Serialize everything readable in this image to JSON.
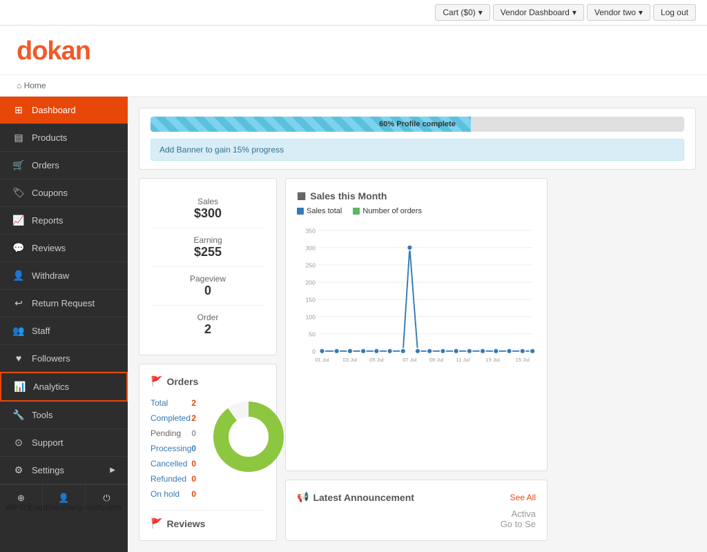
{
  "topnav": {
    "cart_label": "Cart ($0)",
    "vendor_dashboard_label": "Vendor Dashboard",
    "vendor_two_label": "Vendor two",
    "logout_label": "Log out"
  },
  "logo": {
    "text": "dokan"
  },
  "breadcrumb": {
    "home": "Home"
  },
  "sidebar": {
    "items": [
      {
        "id": "dashboard",
        "label": "Dashboard",
        "icon": "⊞",
        "active": true
      },
      {
        "id": "products",
        "label": "Products",
        "icon": "▤",
        "active": false
      },
      {
        "id": "orders",
        "label": "Orders",
        "icon": "🛒",
        "active": false
      },
      {
        "id": "coupons",
        "label": "Coupons",
        "icon": "🏷",
        "active": false
      },
      {
        "id": "reports",
        "label": "Reports",
        "icon": "📈",
        "active": false
      },
      {
        "id": "reviews",
        "label": "Reviews",
        "icon": "💬",
        "active": false
      },
      {
        "id": "withdraw",
        "label": "Withdraw",
        "icon": "👤",
        "active": false
      },
      {
        "id": "return-request",
        "label": "Return Request",
        "icon": "↩",
        "active": false
      },
      {
        "id": "staff",
        "label": "Staff",
        "icon": "👥",
        "active": false
      },
      {
        "id": "followers",
        "label": "Followers",
        "icon": "♥",
        "active": false
      },
      {
        "id": "analytics",
        "label": "Analytics",
        "icon": "📊",
        "active": false,
        "selected": true
      },
      {
        "id": "tools",
        "label": "Tools",
        "icon": "🔧",
        "active": false
      },
      {
        "id": "support",
        "label": "Support",
        "icon": "⊙",
        "active": false
      },
      {
        "id": "settings",
        "label": "Settings",
        "icon": "⚙",
        "active": false,
        "has_arrow": true
      }
    ]
  },
  "progress": {
    "label": "60% Profile complete",
    "percent": 60,
    "banner_text": "Add Banner to gain 15% progress"
  },
  "stats": {
    "sales_label": "Sales",
    "sales_value": "$300",
    "earning_label": "Earning",
    "earning_value": "$255",
    "pageview_label": "Pageview",
    "pageview_value": "0",
    "order_label": "Order",
    "order_value": "2"
  },
  "orders": {
    "title": "Orders",
    "rows": [
      {
        "label": "Total",
        "value": "2",
        "color": "orange",
        "link": true
      },
      {
        "label": "Completed",
        "value": "2",
        "color": "orange",
        "link": true
      },
      {
        "label": "Pending",
        "value": "0",
        "color": "gray",
        "link": false
      },
      {
        "label": "Processing",
        "value": "0",
        "color": "blue",
        "link": true
      },
      {
        "label": "Cancelled",
        "value": "0",
        "color": "orange",
        "link": true
      },
      {
        "label": "Refunded",
        "value": "0",
        "color": "orange",
        "link": true
      },
      {
        "label": "On hold",
        "value": "0",
        "color": "orange",
        "link": true
      }
    ]
  },
  "chart": {
    "title": "Sales this Month",
    "legend": [
      {
        "label": "Sales total",
        "color": "#337ab7"
      },
      {
        "label": "Number of orders",
        "color": "#5cb85c"
      }
    ],
    "y_max": 350,
    "y_labels": [
      "350",
      "300",
      "250",
      "200",
      "150",
      "100",
      "50",
      "0"
    ],
    "x_labels": [
      "01 Jul",
      "03 Jul",
      "05 Jul",
      "07 Jul",
      "09 Jul",
      "11 Jul",
      "13 Jul",
      "15 Jul"
    ],
    "peak_label": "300",
    "peak_x": "07 Jul"
  },
  "announcement": {
    "title": "Latest Announcement",
    "see_all": "See All",
    "content_preview": "Activa\nGo to Se"
  },
  "reviews": {
    "title": "Reviews"
  },
  "watermark": "WP中文 wpzhanzhang.eastfu.com"
}
